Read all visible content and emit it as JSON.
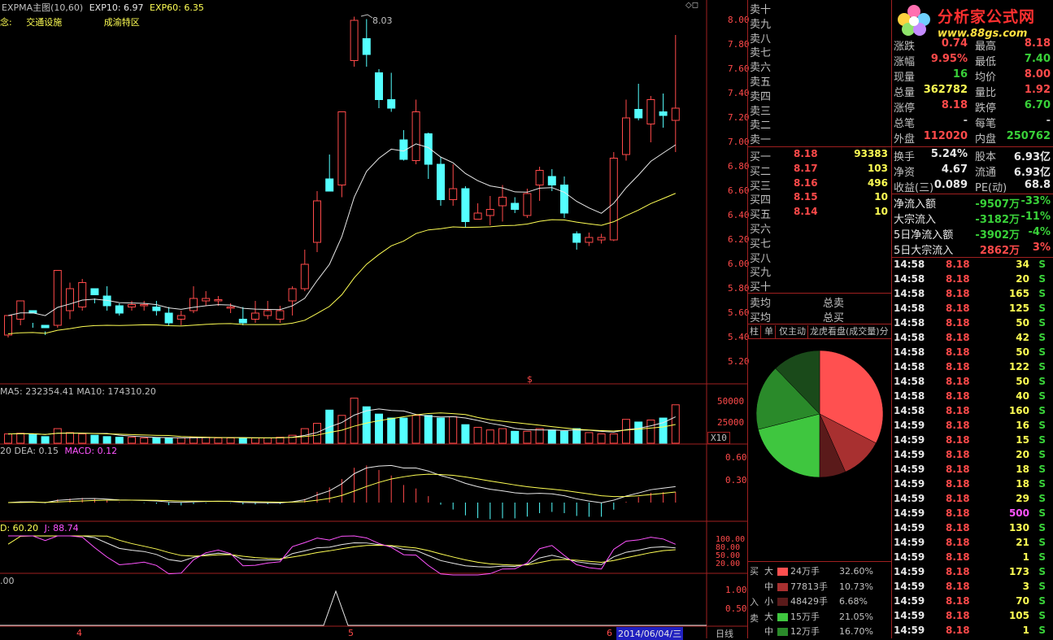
{
  "header": {
    "title": "EXPMA主图(10,60)",
    "exp10": "EXP10: 6.97",
    "exp60": "EXP60: 6.35",
    "tag_prefix": "念:",
    "tag1": "交通设施",
    "tag2": "成渝特区",
    "peak_label": "8.03",
    "marker": "$"
  },
  "colors": {
    "up": "#ff4a4a",
    "down": "#54ffff",
    "ma_white": "#e8e8e8",
    "ma_yellow": "#ffff54",
    "magenta": "#ff54ff",
    "grid": "#a02020"
  },
  "price_axis": [
    "8.00",
    "7.80",
    "7.60",
    "7.40",
    "7.20",
    "7.00",
    "6.80",
    "6.60",
    "6.40",
    "6.20",
    "6.00",
    "5.80",
    "5.60",
    "5.40",
    "5.20"
  ],
  "volume": {
    "label": "MA5: 232354.41  MA10: 174310.20",
    "axis": [
      "50000",
      "25000"
    ],
    "unit": "X10"
  },
  "macd": {
    "label_dea": "20  DEA: 0.15",
    "label_macd": "MACD: 0.12",
    "axis": [
      "0.60",
      "0.30"
    ]
  },
  "kdj": {
    "label_d": "D: 60.20",
    "label_j": "J: 88.74",
    "axis": [
      "100.00",
      "80.00",
      "50.00",
      "20.00"
    ]
  },
  "signal": {
    "label": ".00",
    "axis": [
      "1.00",
      "0.50"
    ]
  },
  "date_axis": {
    "marks": [
      "4",
      "5",
      "6"
    ],
    "current": "2014/06/04/三",
    "period": "日线"
  },
  "chart_data": {
    "type": "candlestick",
    "candles": [
      [
        5.42,
        5.58,
        5.45,
        5.4
      ],
      [
        5.55,
        5.7,
        5.58,
        5.5
      ],
      [
        5.62,
        5.6,
        5.52,
        5.48
      ],
      [
        5.5,
        5.48,
        5.45,
        5.42
      ],
      [
        5.5,
        5.95,
        5.62,
        5.48
      ],
      [
        5.62,
        5.8,
        5.85,
        5.55
      ],
      [
        5.65,
        5.85,
        5.88,
        5.62
      ],
      [
        5.8,
        5.75,
        5.72,
        5.68
      ],
      [
        5.74,
        5.66,
        5.82,
        5.62
      ],
      [
        5.66,
        5.6,
        5.68,
        5.58
      ],
      [
        5.65,
        5.67,
        5.7,
        5.62
      ],
      [
        5.66,
        5.67,
        5.7,
        5.62
      ],
      [
        5.65,
        5.62,
        5.7,
        5.58
      ],
      [
        5.6,
        5.52,
        5.65,
        5.5
      ],
      [
        5.55,
        5.58,
        5.62,
        5.5
      ],
      [
        5.62,
        5.72,
        5.82,
        5.6
      ],
      [
        5.7,
        5.72,
        5.78,
        5.66
      ],
      [
        5.7,
        5.71,
        5.74,
        5.66
      ],
      [
        5.64,
        5.65,
        5.68,
        5.6
      ],
      [
        5.55,
        5.52,
        5.65,
        5.5
      ],
      [
        5.55,
        5.6,
        5.7,
        5.52
      ],
      [
        5.58,
        5.62,
        5.7,
        5.55
      ],
      [
        5.55,
        5.62,
        5.66,
        5.52
      ],
      [
        5.7,
        5.8,
        5.82,
        5.58
      ],
      [
        5.8,
        6.0,
        6.12,
        5.78
      ],
      [
        6.18,
        6.52,
        6.6,
        6.1
      ],
      [
        6.7,
        6.6,
        6.9,
        6.6
      ],
      [
        6.65,
        7.25,
        7.25,
        6.55
      ],
      [
        7.67,
        8.0,
        8.03,
        7.62
      ],
      [
        7.85,
        7.72,
        8.01,
        7.62
      ],
      [
        7.57,
        7.35,
        7.6,
        7.28
      ],
      [
        7.35,
        7.28,
        7.57,
        7.25
      ],
      [
        7.02,
        6.86,
        7.1,
        6.85
      ],
      [
        6.85,
        7.25,
        7.35,
        6.82
      ],
      [
        7.07,
        6.82,
        7.08,
        6.7
      ],
      [
        6.82,
        6.53,
        6.88,
        6.48
      ],
      [
        6.53,
        6.62,
        6.82,
        6.48
      ],
      [
        6.62,
        6.35,
        6.64,
        6.3
      ],
      [
        6.37,
        6.42,
        6.5,
        6.38
      ],
      [
        6.4,
        6.45,
        6.56,
        6.32
      ],
      [
        6.48,
        6.55,
        6.65,
        6.35
      ],
      [
        6.5,
        6.45,
        6.55,
        6.42
      ],
      [
        6.4,
        6.58,
        6.62,
        6.38
      ],
      [
        6.65,
        6.77,
        6.8,
        6.52
      ],
      [
        6.72,
        6.65,
        6.78,
        6.6
      ],
      [
        6.65,
        6.42,
        6.72,
        6.38
      ],
      [
        6.25,
        6.18,
        6.27,
        6.12
      ],
      [
        6.18,
        6.22,
        6.26,
        6.15
      ],
      [
        6.2,
        6.22,
        6.25,
        6.17
      ],
      [
        6.2,
        6.87,
        6.92,
        6.19
      ],
      [
        6.9,
        7.2,
        7.35,
        6.85
      ],
      [
        7.27,
        7.2,
        7.48,
        7.18
      ],
      [
        7.15,
        7.35,
        7.38,
        7.0
      ],
      [
        7.25,
        7.22,
        7.4,
        7.12
      ],
      [
        7.18,
        7.28,
        7.88,
        6.92
      ]
    ],
    "volume": [
      14,
      15,
      14,
      10,
      22,
      16,
      14,
      12,
      10,
      9,
      9,
      8,
      8,
      8,
      8,
      9,
      9,
      8,
      8,
      8,
      8,
      8,
      9,
      12,
      22,
      30,
      50,
      42,
      68,
      55,
      44,
      38,
      38,
      42,
      42,
      38,
      40,
      28,
      24,
      20,
      22,
      18,
      18,
      22,
      20,
      18,
      22,
      16,
      14,
      14,
      36,
      32,
      35,
      38,
      58
    ],
    "ylim": [
      5.1,
      8.1
    ]
  },
  "orderbook": {
    "sell": [
      {
        "label": "卖十"
      },
      {
        "label": "卖九"
      },
      {
        "label": "卖八"
      },
      {
        "label": "卖七"
      },
      {
        "label": "卖六"
      },
      {
        "label": "卖五"
      },
      {
        "label": "卖四"
      },
      {
        "label": "卖三"
      },
      {
        "label": "卖二"
      },
      {
        "label": "卖一"
      }
    ],
    "buy": [
      {
        "label": "买一",
        "price": "8.18",
        "vol": "93383"
      },
      {
        "label": "买二",
        "price": "8.17",
        "vol": "103"
      },
      {
        "label": "买三",
        "price": "8.16",
        "vol": "496"
      },
      {
        "label": "买四",
        "price": "8.15",
        "vol": "10"
      },
      {
        "label": "买五",
        "price": "8.14",
        "vol": "10"
      },
      {
        "label": "买六",
        "price": "",
        "vol": ""
      },
      {
        "label": "买七",
        "price": "",
        "vol": ""
      },
      {
        "label": "买八",
        "price": "",
        "vol": ""
      },
      {
        "label": "买九",
        "price": "",
        "vol": ""
      },
      {
        "label": "买十",
        "price": "",
        "vol": ""
      }
    ],
    "sell_avg": "卖均",
    "buy_avg": "买均",
    "total_sell": "总卖",
    "total_buy": "总买"
  },
  "tabs": [
    "柱",
    "单",
    "仅主动",
    "龙虎看盘(成交量)分"
  ],
  "quote": {
    "logo_text": "分析家公式网",
    "logo_url": "www.88gs.com",
    "rows": [
      {
        "l1": "涨跌",
        "v1": "0.74",
        "l2": "最高",
        "v2": "8.18",
        "c1": "red",
        "c2": "red"
      },
      {
        "l1": "涨幅",
        "v1": "9.95%",
        "l2": "最低",
        "v2": "7.40",
        "c1": "red",
        "c2": "green"
      },
      {
        "l1": "现量",
        "v1": "16",
        "l2": "均价",
        "v2": "8.00",
        "c1": "green",
        "c2": "red"
      },
      {
        "l1": "总量",
        "v1": "362782",
        "l2": "量比",
        "v2": "1.92",
        "c1": "yellow",
        "c2": "red"
      },
      {
        "l1": "涨停",
        "v1": "8.18",
        "l2": "跌停",
        "v2": "6.70",
        "c1": "red",
        "c2": "green"
      },
      {
        "l1": "总笔",
        "v1": "-",
        "l2": "每笔",
        "v2": "-",
        "c1": "gray",
        "c2": "gray"
      },
      {
        "l1": "外盘",
        "v1": "112020",
        "l2": "内盘",
        "v2": "250762",
        "c1": "red",
        "c2": "green"
      },
      {
        "l1": "换手",
        "v1": "5.24%",
        "l2": "股本",
        "v2": "6.93亿",
        "c1": "white",
        "c2": "white"
      },
      {
        "l1": "净资",
        "v1": "4.67",
        "l2": "流通",
        "v2": "6.93亿",
        "c1": "white",
        "c2": "white"
      },
      {
        "l1": "收益(三)",
        "v1": "0.089",
        "l2": "PE(动)",
        "v2": "68.8",
        "c1": "white",
        "c2": "white"
      }
    ],
    "flows": [
      {
        "label": "净流入额",
        "value": "-9507万",
        "pct": "-33%",
        "c": "green"
      },
      {
        "label": "大宗流入",
        "value": "-3182万",
        "pct": "-11%",
        "c": "green"
      },
      {
        "label": "5日净流入额",
        "value": "-3902万",
        "pct": "-4%",
        "c": "green"
      },
      {
        "label": "5日大宗流入",
        "value": "2862万",
        "pct": "3%",
        "c": "red"
      }
    ]
  },
  "trades": [
    {
      "t": "14:58",
      "p": "8.18",
      "v": "34",
      "s": "S",
      "vc": "yellow"
    },
    {
      "t": "14:58",
      "p": "8.18",
      "v": "20",
      "s": "S",
      "vc": "yellow"
    },
    {
      "t": "14:58",
      "p": "8.18",
      "v": "165",
      "s": "S",
      "vc": "yellow"
    },
    {
      "t": "14:58",
      "p": "8.18",
      "v": "125",
      "s": "S",
      "vc": "yellow"
    },
    {
      "t": "14:58",
      "p": "8.18",
      "v": "50",
      "s": "S",
      "vc": "yellow"
    },
    {
      "t": "14:58",
      "p": "8.18",
      "v": "42",
      "s": "S",
      "vc": "yellow"
    },
    {
      "t": "14:58",
      "p": "8.18",
      "v": "50",
      "s": "S",
      "vc": "yellow"
    },
    {
      "t": "14:58",
      "p": "8.18",
      "v": "122",
      "s": "S",
      "vc": "yellow"
    },
    {
      "t": "14:58",
      "p": "8.18",
      "v": "50",
      "s": "S",
      "vc": "yellow"
    },
    {
      "t": "14:58",
      "p": "8.18",
      "v": "40",
      "s": "S",
      "vc": "yellow"
    },
    {
      "t": "14:58",
      "p": "8.18",
      "v": "160",
      "s": "S",
      "vc": "yellow"
    },
    {
      "t": "14:59",
      "p": "8.18",
      "v": "16",
      "s": "S",
      "vc": "yellow"
    },
    {
      "t": "14:59",
      "p": "8.18",
      "v": "15",
      "s": "S",
      "vc": "yellow"
    },
    {
      "t": "14:59",
      "p": "8.18",
      "v": "20",
      "s": "S",
      "vc": "yellow"
    },
    {
      "t": "14:59",
      "p": "8.18",
      "v": "18",
      "s": "S",
      "vc": "yellow"
    },
    {
      "t": "14:59",
      "p": "8.18",
      "v": "18",
      "s": "S",
      "vc": "yellow"
    },
    {
      "t": "14:59",
      "p": "8.18",
      "v": "29",
      "s": "S",
      "vc": "yellow"
    },
    {
      "t": "14:59",
      "p": "8.18",
      "v": "500",
      "s": "S",
      "vc": "magenta"
    },
    {
      "t": "14:59",
      "p": "8.18",
      "v": "130",
      "s": "S",
      "vc": "yellow"
    },
    {
      "t": "14:59",
      "p": "8.18",
      "v": "21",
      "s": "S",
      "vc": "yellow"
    },
    {
      "t": "14:59",
      "p": "8.18",
      "v": "1",
      "s": "S",
      "vc": "yellow"
    },
    {
      "t": "14:59",
      "p": "8.18",
      "v": "173",
      "s": "S",
      "vc": "yellow"
    },
    {
      "t": "14:59",
      "p": "8.18",
      "v": "3",
      "s": "S",
      "vc": "yellow"
    },
    {
      "t": "14:59",
      "p": "8.18",
      "v": "70",
      "s": "S",
      "vc": "yellow"
    },
    {
      "t": "14:59",
      "p": "8.18",
      "v": "105",
      "s": "S",
      "vc": "yellow"
    },
    {
      "t": "14:59",
      "p": "8.18",
      "v": "1",
      "s": "S",
      "vc": "yellow"
    }
  ],
  "flow_pie": {
    "buy_label": "买入",
    "sell_label": "卖",
    "rows": [
      {
        "side": "买",
        "size": "大",
        "amount": "24万手",
        "pct": "32.60%",
        "color": "#ff5050",
        "value": 32.6
      },
      {
        "side": "",
        "size": "中",
        "amount": "77813手",
        "pct": "10.73%",
        "color": "#a83030",
        "value": 10.73
      },
      {
        "side": "入",
        "size": "小",
        "amount": "48429手",
        "pct": "6.68%",
        "color": "#5a1a1a",
        "value": 6.68
      },
      {
        "side": "卖",
        "size": "大",
        "amount": "15万手",
        "pct": "21.05%",
        "color": "#3fc63f",
        "value": 21.05
      },
      {
        "side": "",
        "size": "中",
        "amount": "12万手",
        "pct": "16.70%",
        "color": "#2a8a2a",
        "value": 16.7
      },
      {
        "side": "",
        "size": "小",
        "amount": "",
        "pct": "",
        "color": "#1a4a1a",
        "value": 12.24
      }
    ]
  }
}
